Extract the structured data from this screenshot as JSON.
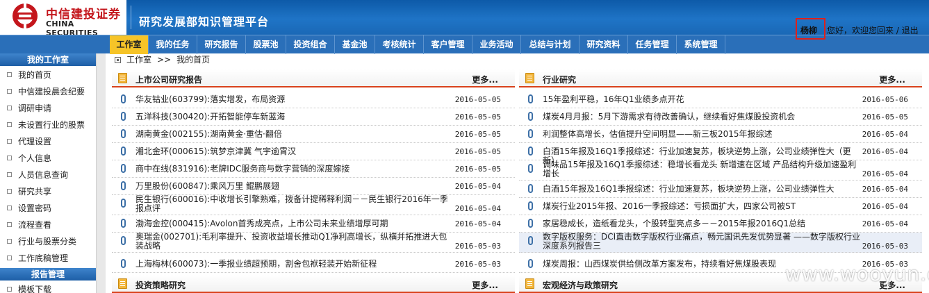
{
  "header": {
    "company_cn": "中信建投证券",
    "company_en": "CHINA SECURITIES",
    "app_title": "研究发展部知识管理平台",
    "user_name": "杨柳",
    "greeting": "您好，欢迎您回来 / 退出",
    "brand_color": "#c4161c"
  },
  "nav": {
    "items": [
      {
        "label": "工作室",
        "active": true
      },
      {
        "label": "我的任务"
      },
      {
        "label": "研究报告"
      },
      {
        "label": "股票池"
      },
      {
        "label": "投资组合"
      },
      {
        "label": "基金池"
      },
      {
        "label": "考核统计"
      },
      {
        "label": "客户管理"
      },
      {
        "label": "业务活动"
      },
      {
        "label": "总结与计划"
      },
      {
        "label": "研究资料"
      },
      {
        "label": "任务管理"
      },
      {
        "label": "系统管理"
      }
    ]
  },
  "sidebar": {
    "section1": "我的工作室",
    "items": [
      "我的首页",
      "中信建投晨会纪要",
      "调研申请",
      "未设置行业的股票",
      "代理设置",
      "个人信息",
      "人员信息查询",
      "研究共享",
      "设置密码",
      "流程查看",
      "行业与股票分类",
      "工作底稿管理"
    ],
    "section2": "报告管理",
    "section2_items": [
      "模板下载"
    ]
  },
  "breadcrumb": {
    "items": [
      "工作室",
      ">>",
      "我的首页"
    ]
  },
  "panels": {
    "left": {
      "title": "上市公司研究报告",
      "more": "更多...",
      "rows": [
        {
          "text": "华友钴业(603799):落实增发，布局资源",
          "date": "2016-05-05"
        },
        {
          "text": "五洋科技(300420):开拓智能停车新蓝海",
          "date": "2016-05-05"
        },
        {
          "text": "湖南黄金(002155):湖南黄金·重估·翻倍",
          "date": "2016-05-05"
        },
        {
          "text": "湘北金环(000615):筑梦京津冀  气宇逾霄汉",
          "date": "2016-05-05"
        },
        {
          "text": "商中在线(831916):老牌IDC服务商与数字营销的深度嫁接",
          "date": "2016-05-05"
        },
        {
          "text": "万里股份(600847):乘风万里  鲲鹏展翅",
          "date": "2016-05-04"
        },
        {
          "text": "民生银行(600016):中收增长引擎熟难，拨备计提稀释利润－－民生银行2016年一季报点评",
          "date": "2016-05-04"
        },
        {
          "text": "渤海金控(000415):Avolon首秀成亮点，上市公司未来业绩增厚可期",
          "date": "2016-05-04"
        },
        {
          "text": "奥瑞金(002701):毛利率提升、投资收益增长推动Q1净利高增长，纵横并拓推进大包装战略",
          "date": "2016-05-03"
        },
        {
          "text": "上海梅林(600073):一季报业绩超预期，割舍包袱轻装开始新征程",
          "date": "2016-05-03"
        }
      ]
    },
    "right": {
      "title": "行业研究",
      "more": "更多...",
      "rows": [
        {
          "text": "15年盈利平稳，16年Q1业绩多点开花",
          "date": "2016-05-06"
        },
        {
          "text": "煤炭4月月报：5月下游需求有待改善确认，继续看好焦煤股投资机会",
          "date": "2016-05-05"
        },
        {
          "text": "利润整体高增长，估值提升空间明显——新三板2015年报综述",
          "date": "2016-05-04"
        },
        {
          "text": "白酒15年报及16Q1季报综述：行业加速复苏，板块逆势上涨，公司业绩弹性大（更新）",
          "date": "2016-05-04"
        },
        {
          "text": "调味品15年报及16Q1季报综述：稳增长看龙头  新增速在区域  产品结构升级加速盈利增长",
          "date": "2016-05-04"
        },
        {
          "text": "白酒15年报及16Q1季报综述：行业加速复苏，板块逆势上涨，公司业绩弹性大",
          "date": "2016-05-04"
        },
        {
          "text": "煤炭行业2015年报、2016一季报综述：亏损面扩大，四家公司被ST",
          "date": "2016-05-04"
        },
        {
          "text": "家居稳成长，造纸看龙头，个股转型亮点多－－2015年报2016Q1总结",
          "date": "2016-05-04"
        },
        {
          "text": "数字版权服务：DCI直击数字版权行业痛点，畅元国讯先发优势显著  ——数字版权行业深度系列报告三",
          "date": "2016-05-03"
        },
        {
          "text": "煤炭周报：山西煤炭供给侧改革方案发布，持续看好焦煤股表现",
          "date": "2016-05-03"
        }
      ]
    },
    "bottom_left": {
      "title": "投资策略研究",
      "more": "更多..."
    },
    "bottom_right": {
      "title": "宏观经济与政策研究",
      "more": "更多..."
    }
  },
  "watermark": "www.wooyun.org"
}
